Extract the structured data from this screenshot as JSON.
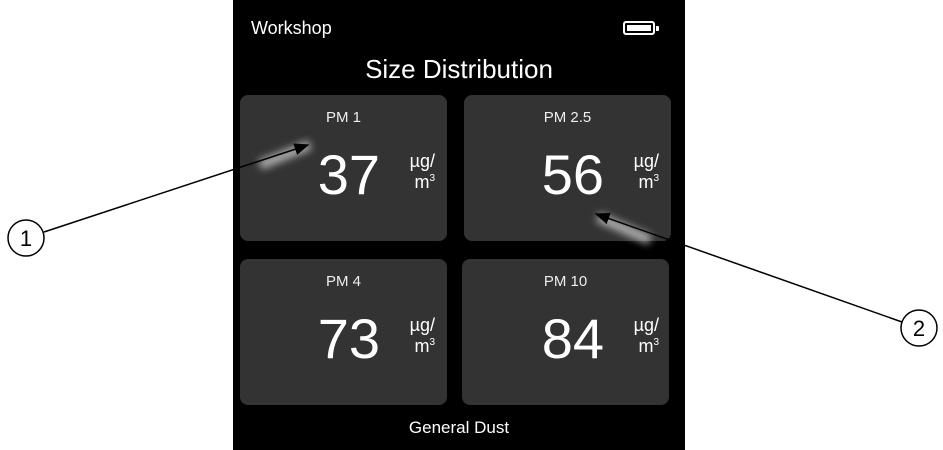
{
  "device": {
    "location": "Workshop",
    "title": "Size Distribution",
    "footer": "General Dust",
    "battery_level": 1.0
  },
  "tiles": [
    {
      "label": "PM 1",
      "value": "37",
      "unit_top": "µg/",
      "unit_bottom": "m",
      "unit_exp": "3"
    },
    {
      "label": "PM 2.5",
      "value": "56",
      "unit_top": "µg/",
      "unit_bottom": "m",
      "unit_exp": "3"
    },
    {
      "label": "PM 4",
      "value": "73",
      "unit_top": "µg/",
      "unit_bottom": "m",
      "unit_exp": "3"
    },
    {
      "label": "PM 10",
      "value": "84",
      "unit_top": "µg/",
      "unit_bottom": "m",
      "unit_exp": "3"
    }
  ],
  "callouts": [
    {
      "label": "1"
    },
    {
      "label": "2"
    }
  ],
  "colors": {
    "screen_bg": "#000000",
    "tile_bg": "#333333",
    "text": "#ffffff",
    "page_bg": "#ffffff"
  }
}
